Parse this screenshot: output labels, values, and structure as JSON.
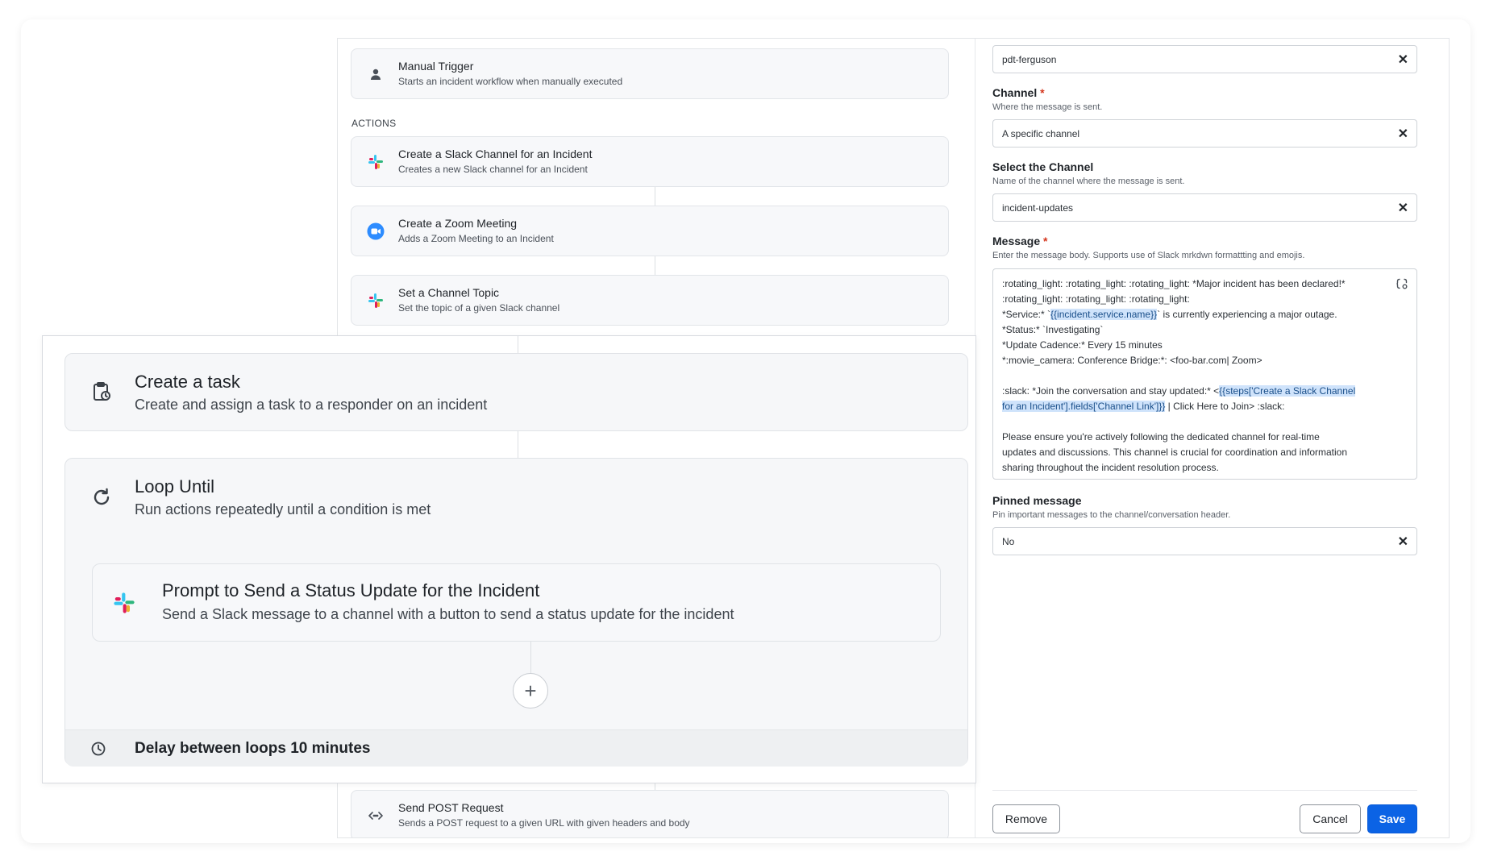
{
  "trigger": {
    "title": "Manual Trigger",
    "desc": "Starts an incident workflow when manually executed",
    "icon": "person-icon"
  },
  "actions_label": "ACTIONS",
  "steps": [
    {
      "title": "Create a Slack Channel for an Incident",
      "desc": "Creates a new Slack channel for an Incident",
      "icon": "slack-icon"
    },
    {
      "title": "Create a Zoom Meeting",
      "desc": "Adds a Zoom Meeting to an Incident",
      "icon": "zoom-icon"
    },
    {
      "title": "Set a Channel Topic",
      "desc": "Set the topic of a given Slack channel",
      "icon": "slack-icon"
    },
    {
      "title": "Send POST Request",
      "desc": "Sends a POST request to a given URL with given headers and body",
      "icon": "code-icon"
    }
  ],
  "zoom": {
    "task": {
      "title": "Create a task",
      "desc": "Create and assign a task to a responder on an incident",
      "icon": "clipboard-clock-icon"
    },
    "loop": {
      "title": "Loop Until",
      "desc": "Run actions repeatedly until a condition is met",
      "icon": "refresh-icon"
    },
    "prompt": {
      "title": "Prompt to Send a Status Update for the Incident",
      "desc": "Send a Slack message to a channel with a button to send a status update for the incident",
      "icon": "slack-icon"
    },
    "add_label": "+",
    "delay": "Delay between loops 10 minutes"
  },
  "form": {
    "top_value": "pdt-ferguson",
    "channel": {
      "label": "Channel",
      "required": "*",
      "help": "Where the message is sent.",
      "value": "A specific channel"
    },
    "select_channel": {
      "label": "Select the Channel",
      "help": "Name of the channel where the message is sent.",
      "value": "incident-updates"
    },
    "message": {
      "label": "Message",
      "required": "*",
      "help": "Enter the message body. Supports use of Slack mrkdwn formattting and emojis.",
      "lines": {
        "l1": ":rotating_light: :rotating_light: :rotating_light: *Major incident has been declared!*",
        "l2": ":rotating_light: :rotating_light: :rotating_light:",
        "l3_pre": "*Service:* `",
        "l3_var": "{{incident.service.name}}",
        "l3_post": "` is currently experiencing a major outage.",
        "l4": "*Status:* `Investigating`",
        "l5": "*Update Cadence:* Every 15 minutes",
        "l6": "*:movie_camera: Conference Bridge:*: <foo-bar.com| Zoom>",
        "l8_pre": ":slack: *Join the conversation and stay updated:* <",
        "l8_var": "{{steps['Create a Slack Channel",
        "l9_var": "for an Incident'].fields['Channel Link']}}",
        "l9_post": " | Click Here to Join> :slack:",
        "l11": "Please ensure you're actively following the dedicated channel for real-time",
        "l12": "updates and discussions. This channel is crucial for coordination and information",
        "l13": "sharing throughout the incident resolution process."
      }
    },
    "pinned": {
      "label": "Pinned message",
      "help": "Pin important messages to the channel/conversation header.",
      "value": "No"
    },
    "clear_glyph": "✕",
    "buttons": {
      "remove": "Remove",
      "cancel": "Cancel",
      "save": "Save"
    }
  },
  "colors": {
    "primary": "#0b63e5",
    "required": "#d4351c",
    "highlight": "#cfe3fb"
  }
}
